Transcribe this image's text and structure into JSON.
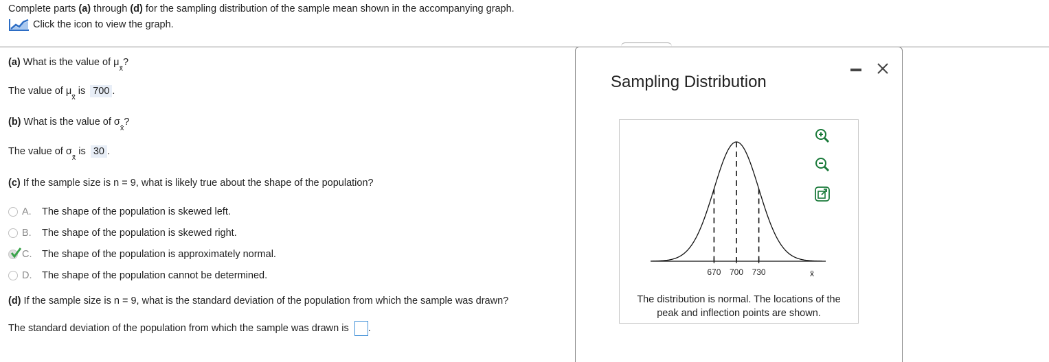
{
  "intro": {
    "text_before": "Complete parts ",
    "part_a": "(a)",
    "text_mid": " through ",
    "part_d": "(d)",
    "text_after": " for the sampling distribution of the sample mean shown in the accompanying graph.",
    "link_label": "Click the icon to view the graph.",
    "link_icon": "line-chart-icon"
  },
  "part_a": {
    "label": "(a)",
    "question": " What is the value of μ",
    "answer_prefix": "The value of μ",
    "answer_mid": " is ",
    "answer": "700"
  },
  "part_b": {
    "label": "(b)",
    "question": " What is the value of σ",
    "answer_prefix": "The value of σ",
    "answer_mid": " is ",
    "answer": "30"
  },
  "part_c": {
    "label": "(c)",
    "question": " If the sample size is n = 9, what is likely true about the shape of the population?",
    "choices": [
      {
        "letter": "A.",
        "text": "The shape of the population is skewed left."
      },
      {
        "letter": "B.",
        "text": "The shape of the population is skewed right."
      },
      {
        "letter": "C.",
        "text": "The shape of the population is approximately normal."
      },
      {
        "letter": "D.",
        "text": "The shape of the population cannot be determined."
      }
    ],
    "selected_index": 2,
    "check_color": "#3aa34a"
  },
  "part_d": {
    "label": "(d)",
    "question": " If the sample size is n = 9, what is the standard deviation of the population from which the sample was drawn?",
    "answer_prefix": "The standard deviation of the population from which the sample was drawn is",
    "answer": ""
  },
  "popup": {
    "title": "Sampling Distribution",
    "caption_line1": "The distribution is normal. The locations of the",
    "caption_line2": "peak and inflection points are shown.",
    "tools": [
      "zoom-in-icon",
      "zoom-out-icon",
      "open-external-icon"
    ]
  },
  "chart_data": {
    "type": "line",
    "distribution": "normal",
    "mean": 700,
    "sd": 30,
    "x_ticks": [
      "670",
      "700",
      "730"
    ],
    "x_tick_values": [
      670,
      700,
      730
    ],
    "xlabel": "x̄",
    "marked_lines": [
      670,
      700,
      730
    ],
    "xlim": [
      585,
      815
    ]
  },
  "colors": {
    "accent_input": "#3f8fd7",
    "answer_bg": "#e8eef7",
    "link_icon": "#2b6cc4"
  }
}
